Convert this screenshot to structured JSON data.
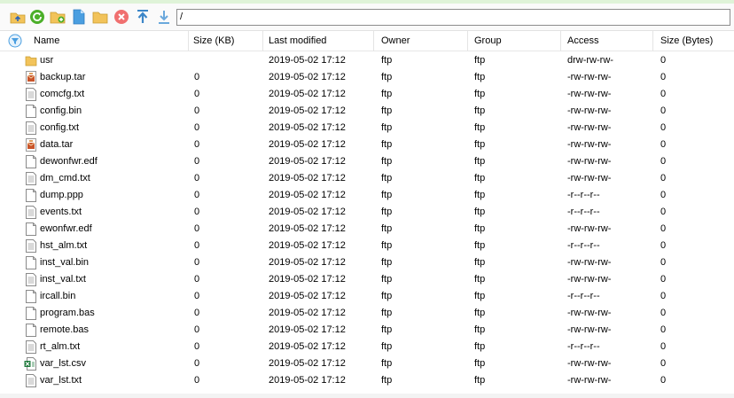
{
  "address_bar": {
    "path": "/"
  },
  "toolbar": {
    "buttons": [
      {
        "name": "go-up-folder",
        "icon": "folder-up-icon"
      },
      {
        "name": "refresh",
        "icon": "refresh-icon"
      },
      {
        "name": "new-folder",
        "icon": "new-folder-icon"
      },
      {
        "name": "new-file",
        "icon": "new-file-icon"
      },
      {
        "name": "open-folder",
        "icon": "folder-icon"
      },
      {
        "name": "delete",
        "icon": "delete-icon"
      },
      {
        "name": "upload",
        "icon": "upload-icon"
      },
      {
        "name": "download",
        "icon": "download-icon"
      }
    ]
  },
  "columns": {
    "name": "Name",
    "size_kb": "Size (KB)",
    "last_modified": "Last modified",
    "owner": "Owner",
    "group": "Group",
    "access": "Access",
    "size_bytes": "Size (Bytes)"
  },
  "files": [
    {
      "name": "usr",
      "size_kb": "",
      "modified": "2019-05-02 17:12",
      "owner": "ftp",
      "group": "ftp",
      "access": "drw-rw-rw-",
      "size_bytes": "0",
      "type": "folder"
    },
    {
      "name": "backup.tar",
      "size_kb": "0",
      "modified": "2019-05-02 17:12",
      "owner": "ftp",
      "group": "ftp",
      "access": "-rw-rw-rw-",
      "size_bytes": "0",
      "type": "archive"
    },
    {
      "name": "comcfg.txt",
      "size_kb": "0",
      "modified": "2019-05-02 17:12",
      "owner": "ftp",
      "group": "ftp",
      "access": "-rw-rw-rw-",
      "size_bytes": "0",
      "type": "text"
    },
    {
      "name": "config.bin",
      "size_kb": "0",
      "modified": "2019-05-02 17:12",
      "owner": "ftp",
      "group": "ftp",
      "access": "-rw-rw-rw-",
      "size_bytes": "0",
      "type": "file"
    },
    {
      "name": "config.txt",
      "size_kb": "0",
      "modified": "2019-05-02 17:12",
      "owner": "ftp",
      "group": "ftp",
      "access": "-rw-rw-rw-",
      "size_bytes": "0",
      "type": "text"
    },
    {
      "name": "data.tar",
      "size_kb": "0",
      "modified": "2019-05-02 17:12",
      "owner": "ftp",
      "group": "ftp",
      "access": "-rw-rw-rw-",
      "size_bytes": "0",
      "type": "archive"
    },
    {
      "name": "dewonfwr.edf",
      "size_kb": "0",
      "modified": "2019-05-02 17:12",
      "owner": "ftp",
      "group": "ftp",
      "access": "-rw-rw-rw-",
      "size_bytes": "0",
      "type": "file"
    },
    {
      "name": "dm_cmd.txt",
      "size_kb": "0",
      "modified": "2019-05-02 17:12",
      "owner": "ftp",
      "group": "ftp",
      "access": "-rw-rw-rw-",
      "size_bytes": "0",
      "type": "text"
    },
    {
      "name": "dump.ppp",
      "size_kb": "0",
      "modified": "2019-05-02 17:12",
      "owner": "ftp",
      "group": "ftp",
      "access": "-r--r--r--",
      "size_bytes": "0",
      "type": "file"
    },
    {
      "name": "events.txt",
      "size_kb": "0",
      "modified": "2019-05-02 17:12",
      "owner": "ftp",
      "group": "ftp",
      "access": "-r--r--r--",
      "size_bytes": "0",
      "type": "text"
    },
    {
      "name": "ewonfwr.edf",
      "size_kb": "0",
      "modified": "2019-05-02 17:12",
      "owner": "ftp",
      "group": "ftp",
      "access": "-rw-rw-rw-",
      "size_bytes": "0",
      "type": "file"
    },
    {
      "name": "hst_alm.txt",
      "size_kb": "0",
      "modified": "2019-05-02 17:12",
      "owner": "ftp",
      "group": "ftp",
      "access": "-r--r--r--",
      "size_bytes": "0",
      "type": "text"
    },
    {
      "name": "inst_val.bin",
      "size_kb": "0",
      "modified": "2019-05-02 17:12",
      "owner": "ftp",
      "group": "ftp",
      "access": "-rw-rw-rw-",
      "size_bytes": "0",
      "type": "file"
    },
    {
      "name": "inst_val.txt",
      "size_kb": "0",
      "modified": "2019-05-02 17:12",
      "owner": "ftp",
      "group": "ftp",
      "access": "-rw-rw-rw-",
      "size_bytes": "0",
      "type": "text"
    },
    {
      "name": "ircall.bin",
      "size_kb": "0",
      "modified": "2019-05-02 17:12",
      "owner": "ftp",
      "group": "ftp",
      "access": "-r--r--r--",
      "size_bytes": "0",
      "type": "file"
    },
    {
      "name": "program.bas",
      "size_kb": "0",
      "modified": "2019-05-02 17:12",
      "owner": "ftp",
      "group": "ftp",
      "access": "-rw-rw-rw-",
      "size_bytes": "0",
      "type": "file"
    },
    {
      "name": "remote.bas",
      "size_kb": "0",
      "modified": "2019-05-02 17:12",
      "owner": "ftp",
      "group": "ftp",
      "access": "-rw-rw-rw-",
      "size_bytes": "0",
      "type": "file"
    },
    {
      "name": "rt_alm.txt",
      "size_kb": "0",
      "modified": "2019-05-02 17:12",
      "owner": "ftp",
      "group": "ftp",
      "access": "-r--r--r--",
      "size_bytes": "0",
      "type": "text"
    },
    {
      "name": "var_lst.csv",
      "size_kb": "0",
      "modified": "2019-05-02 17:12",
      "owner": "ftp",
      "group": "ftp",
      "access": "-rw-rw-rw-",
      "size_bytes": "0",
      "type": "spreadsheet"
    },
    {
      "name": "var_lst.txt",
      "size_kb": "0",
      "modified": "2019-05-02 17:12",
      "owner": "ftp",
      "group": "ftp",
      "access": "-rw-rw-rw-",
      "size_bytes": "0",
      "type": "text"
    }
  ],
  "colors": {
    "top_strip": "#dff3d8",
    "folder": "#f2c35a",
    "refresh": "#4caf2a",
    "delete": "#f07070",
    "arrow": "#3c86c8",
    "archive": "#c9552a",
    "excel": "#1f7a3c"
  }
}
